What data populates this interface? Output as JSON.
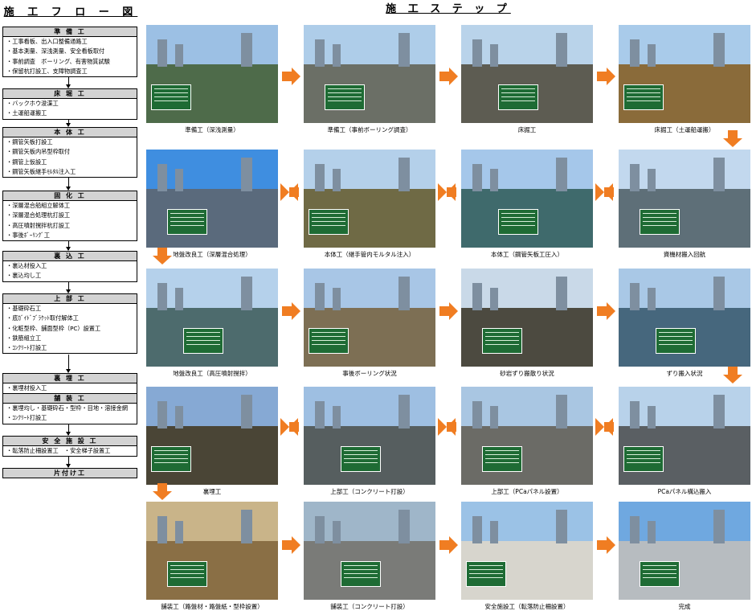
{
  "flow": {
    "title": "施 工 フ ロ ー 図",
    "stages": [
      {
        "name": "準 備 工",
        "items": [
          "・工事看板、出入口整備通路工",
          "・基本測量、深浅測量、安全看板取付",
          "・事前調査　ボーリング、有害物質試験",
          "・保留杭打設工、支障物調査工"
        ]
      },
      {
        "name": "床 堀 工",
        "items": [
          "・バックホウ浚渫工",
          "・土運船運搬工"
        ]
      },
      {
        "name": "本 体 工",
        "items": [
          "・鋼管矢板打設工",
          "・鋼管矢板内吊型枠取付",
          "・鋼管上仮設工",
          "・鋼管矢板継手ﾓﾙﾀﾙ注入工"
        ]
      },
      {
        "name": "固 化 工",
        "items": [
          "・深層混合船組立解体工",
          "・深層混合処理杭打設工",
          "・高圧噴射撹拌杭打設工",
          "・事後ﾎﾞｰﾘﾝｸﾞ工"
        ]
      },
      {
        "name": "裏 込 工",
        "items": [
          "・裏込材投入工",
          "・裏込均し工"
        ]
      },
      {
        "name": "上 部 工",
        "items": [
          "・基礎砕石工",
          "・底ｶﾞｲﾄﾞﾌﾞﾗｹｯﾄ取付解体工",
          "・化粧型枠、舗面型枠（PC）設置工",
          "・鉄筋組立工",
          "・ｺﾝｸﾘｰﾄ打設工"
        ]
      },
      {
        "name": "裏 埋 工",
        "items": [
          "・裏埋材投入工"
        ]
      },
      {
        "name": "舗 装 工",
        "items": [
          "・裏埋均し・基礎砕石・型枠・目地・溶接金網",
          "・ｺﾝｸﾘｰﾄ打設工"
        ]
      },
      {
        "name": "安 全 施 設 工",
        "items": [
          "・転落防止柵設置工　・安全梯子設置工"
        ]
      },
      {
        "name": "片付け工",
        "items": []
      }
    ]
  },
  "steps": {
    "title": "施 工 ス テ ッ プ",
    "items": [
      {
        "caption": "準備工（深浅測量）",
        "colors": [
          "#9cc0e4",
          "#4e6b4a"
        ]
      },
      {
        "caption": "準備工（事前ボーリング調査）",
        "colors": [
          "#aecde9",
          "#6b6f66"
        ]
      },
      {
        "caption": "床掘工",
        "colors": [
          "#b9d3ea",
          "#5d5c52"
        ]
      },
      {
        "caption": "床掘工（土運船運搬）",
        "colors": [
          "#a9cbea",
          "#8a6b3a"
        ]
      },
      {
        "caption": "資機材搬入回航",
        "colors": [
          "#c2d8ee",
          "#5e6f78"
        ]
      },
      {
        "caption": "本体工（鋼管矢板工圧入）",
        "colors": [
          "#a5c7ea",
          "#3f6a6c"
        ]
      },
      {
        "caption": "本体工（継手管内モルタル注入）",
        "colors": [
          "#b4d0ea",
          "#6f6a45"
        ]
      },
      {
        "caption": "地盤改良工（深層混合処理）",
        "colors": [
          "#3f8ee0",
          "#5a6a7c"
        ]
      },
      {
        "caption": "地盤改良工（高圧噴射撹拌）",
        "colors": [
          "#b5d1eb",
          "#4d6b6d"
        ]
      },
      {
        "caption": "事後ボーリング状況",
        "colors": [
          "#a8c6e6",
          "#7d6f54"
        ]
      },
      {
        "caption": "砂岩ずり搬散り状況",
        "colors": [
          "#c9d9e8",
          "#4c4a40"
        ]
      },
      {
        "caption": "ずり搬入状況",
        "colors": [
          "#a9c8e6",
          "#46677d"
        ]
      },
      {
        "caption": "PCaパネル構込搬入",
        "colors": [
          "#b8d2ea",
          "#5a5f63"
        ]
      },
      {
        "caption": "上部工（PCaパネル設置）",
        "colors": [
          "#a9c6e2",
          "#6b6b66"
        ]
      },
      {
        "caption": "上部工（コンクリート打設）",
        "colors": [
          "#9ebfe2",
          "#565e5f"
        ]
      },
      {
        "caption": "裏埋工",
        "colors": [
          "#86a9d4",
          "#4a4536"
        ]
      },
      {
        "caption": "舗装工（路盤材・路盤紙・型枠設置）",
        "colors": [
          "#c9b489",
          "#8a6f45"
        ]
      },
      {
        "caption": "舗装工（コンクリート打設）",
        "colors": [
          "#9fb6c9",
          "#7a7b78"
        ]
      },
      {
        "caption": "安全施設工（転落防止柵設置）",
        "colors": [
          "#9bc2e6",
          "#d7d5cd"
        ]
      },
      {
        "caption": "完成",
        "colors": [
          "#6fa8e0",
          "#b7bcc0"
        ]
      }
    ]
  }
}
